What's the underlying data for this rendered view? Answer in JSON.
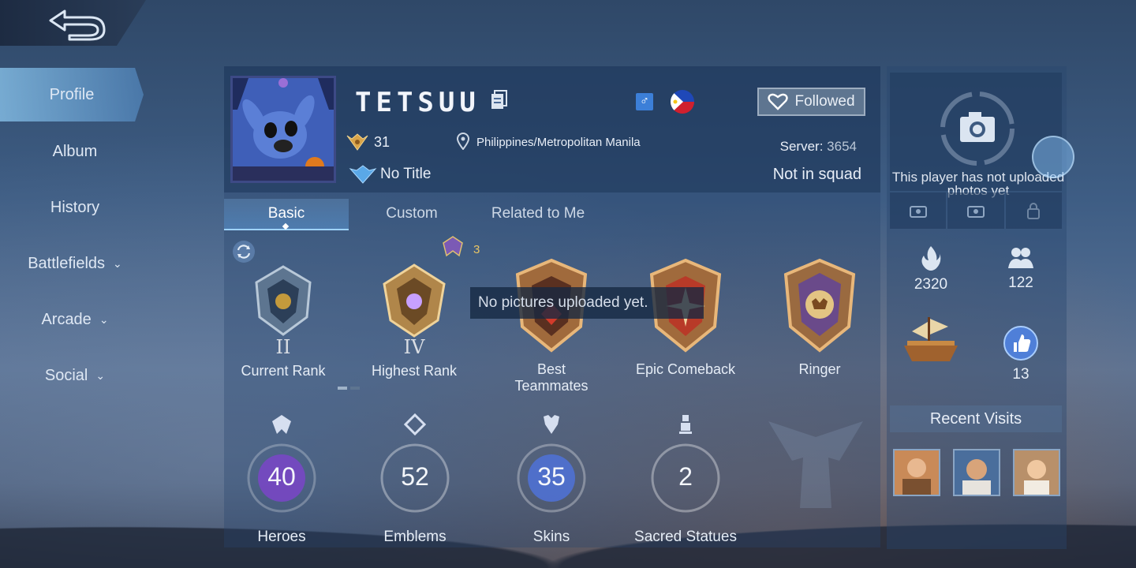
{
  "nav": {
    "items": [
      {
        "label": "Profile",
        "active": true
      },
      {
        "label": "Album"
      },
      {
        "label": "History"
      },
      {
        "label": "Battlefields",
        "has_dropdown": true
      },
      {
        "label": "Arcade",
        "has_dropdown": true
      },
      {
        "label": "Social",
        "has_dropdown": true
      }
    ]
  },
  "profile": {
    "name": "TETSUU",
    "follow_label": "Followed",
    "level": "31",
    "location": "Philippines/Metropolitan Manila",
    "server_label": "Server:",
    "server_value": "3654",
    "title": "No Title",
    "squad": "Not in squad"
  },
  "tabs": [
    {
      "label": "Basic",
      "active": true
    },
    {
      "label": "Custom"
    },
    {
      "label": "Related to Me"
    }
  ],
  "achievements": {
    "rank_count": "3",
    "tooltip": "No pictures uploaded yet.",
    "badges": [
      {
        "label": "Current Rank",
        "tier": "II"
      },
      {
        "label": "Highest Rank",
        "tier": "IV"
      },
      {
        "label": "Best Teammates"
      },
      {
        "label": "Epic Comeback"
      },
      {
        "label": "Ringer"
      }
    ]
  },
  "stats": [
    {
      "label": "Heroes",
      "value": "40"
    },
    {
      "label": "Emblems",
      "value": "52"
    },
    {
      "label": "Skins",
      "value": "35"
    },
    {
      "label": "Sacred Statues",
      "value": "2"
    }
  ],
  "right_panel": {
    "photo_message": "This player has not uploaded photos yet",
    "popularity": "2320",
    "followers": "122",
    "likes": "13",
    "recent_visits_title": "Recent Visits"
  },
  "colors": {
    "accent": "#9fd3ff",
    "gold": "#e8c565",
    "hero_ring": "#8a4fd0",
    "skin_ring": "#5a7fe0"
  }
}
